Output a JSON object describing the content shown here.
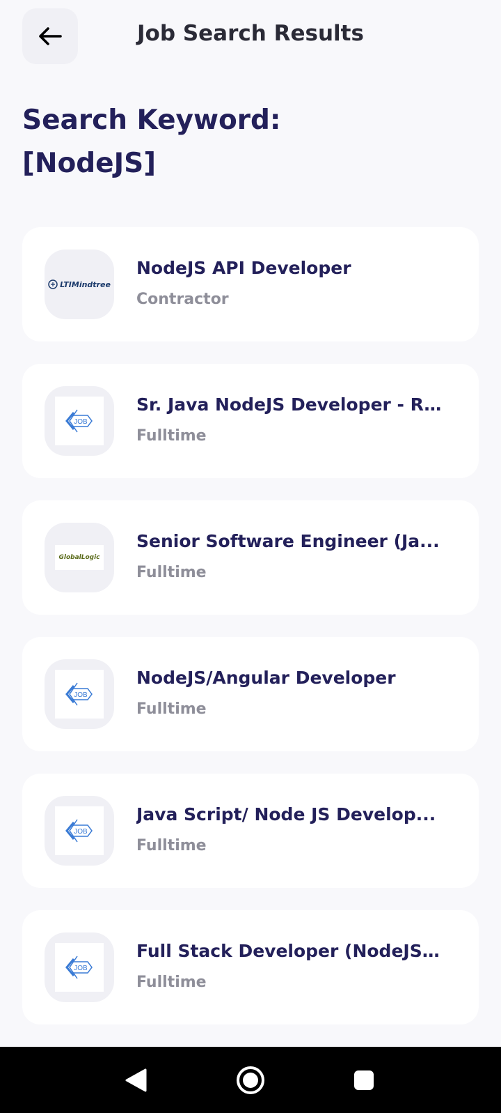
{
  "header": {
    "back_icon": "arrow-left-icon",
    "title": "Job Search Results"
  },
  "keyword": {
    "line1": "Search Keyword:",
    "line2": "[NodeJS]"
  },
  "jobs": [
    {
      "title": "NodeJS API Developer",
      "type": "Contractor",
      "logo": "LTIMindtree"
    },
    {
      "title": "Sr. Java NodeJS Developer - R...",
      "type": "Fulltime",
      "logo": "job-icon"
    },
    {
      "title": "Senior Software Engineer (Ja...",
      "type": "Fulltime",
      "logo": "GlobalLogic"
    },
    {
      "title": "NodeJS/Angular Developer",
      "type": "Fulltime",
      "logo": "job-icon"
    },
    {
      "title": "Java Script/ Node JS Develop...",
      "type": "Fulltime",
      "logo": "job-icon"
    },
    {
      "title": "Full Stack Developer (NodeJS/...",
      "type": "Fulltime",
      "logo": "job-icon"
    }
  ],
  "colors": {
    "background": "#F8F8FB",
    "primary_text": "#23205A",
    "secondary_text": "#8E8E99",
    "card": "#FFFFFF",
    "logo_bg": "#F0F0F5",
    "job_logo_blue": "#3A7BD5"
  },
  "navbar": {
    "back": "nav-back-icon",
    "home": "nav-home-icon",
    "recents": "nav-recents-icon"
  }
}
